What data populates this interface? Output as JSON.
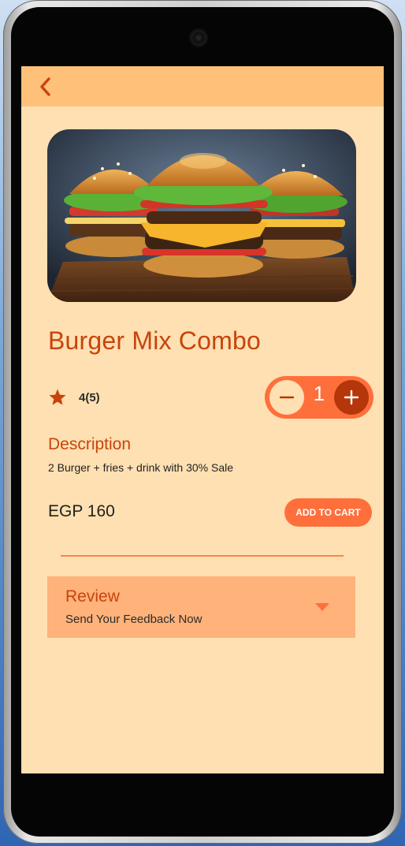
{
  "product": {
    "title": "Burger Mix Combo",
    "rating_text": "4(5)",
    "quantity": "1",
    "description_title": "Description",
    "description_text": "2 Burger + fries + drink with 30% Sale",
    "price": "EGP 160",
    "add_to_cart_label": "ADD TO CART"
  },
  "review": {
    "title": "Review",
    "subtitle": "Send Your Feedback Now"
  },
  "icons": {
    "back": "chevron-left-icon",
    "star": "star-icon",
    "minus": "minus-icon",
    "plus": "plus-icon",
    "expand": "caret-down-icon"
  },
  "colors": {
    "background": "#ffe0b2",
    "app_bar": "#ffc07a",
    "accent": "#ff6f3c",
    "title": "#c8440c",
    "dark_accent": "#b5360a",
    "review_panel": "#ffb27a"
  }
}
